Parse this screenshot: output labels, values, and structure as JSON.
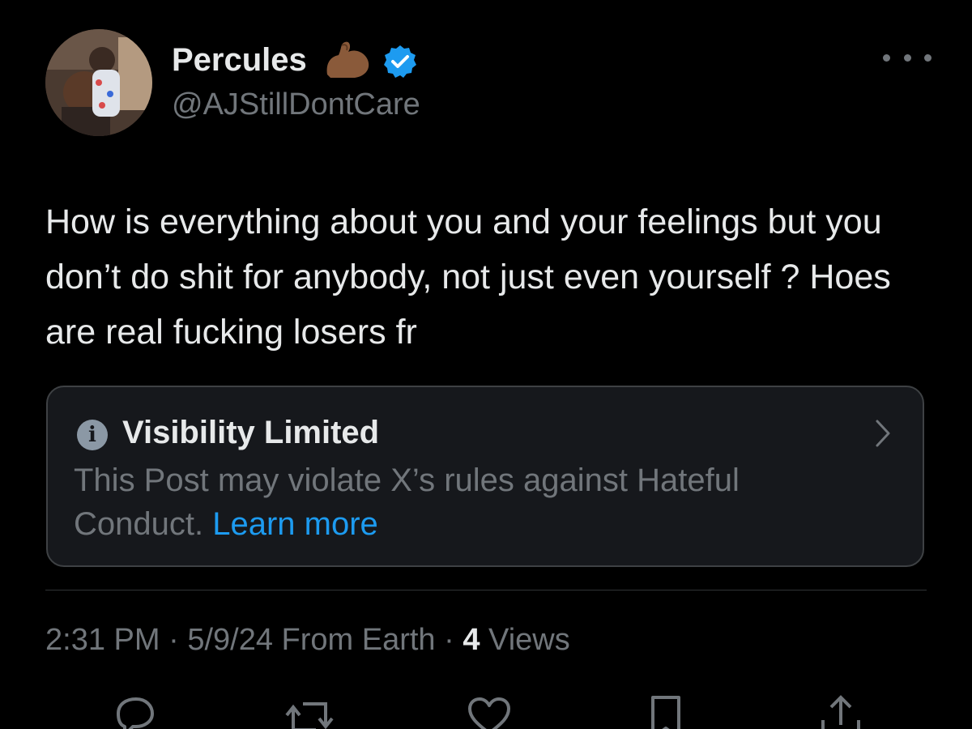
{
  "author": {
    "display_name": "Percules",
    "handle": "@AJStillDontCare",
    "emoji_icon": "flexed-biceps-icon",
    "verified_icon": "verified-badge-icon",
    "verified_color": "#1d9bf0"
  },
  "post": {
    "text": "How is everything about you and your feelings but you don’t do shit for anybody, not just even yourself ? Hoes are real fucking losers fr"
  },
  "notice": {
    "title": "Visibility Limited",
    "body": "This Post may violate X’s rules against Hateful Conduct.",
    "link_label": "Learn more",
    "link_color": "#1d9bf0",
    "icon": "info-icon"
  },
  "meta": {
    "time": "2:31 PM",
    "separator1": " · ",
    "date": "5/9/24",
    "location": " From Earth",
    "separator2": " · ",
    "views_count": "4",
    "views_label": " Views"
  },
  "actions": [
    "reply-icon",
    "repost-icon",
    "like-icon",
    "bookmark-icon",
    "share-icon"
  ],
  "colors": {
    "background": "#000000",
    "primary_text": "#e7e9ea",
    "secondary_text": "#71767b",
    "notice_bg": "#16181c",
    "notice_border": "#3e4144"
  }
}
